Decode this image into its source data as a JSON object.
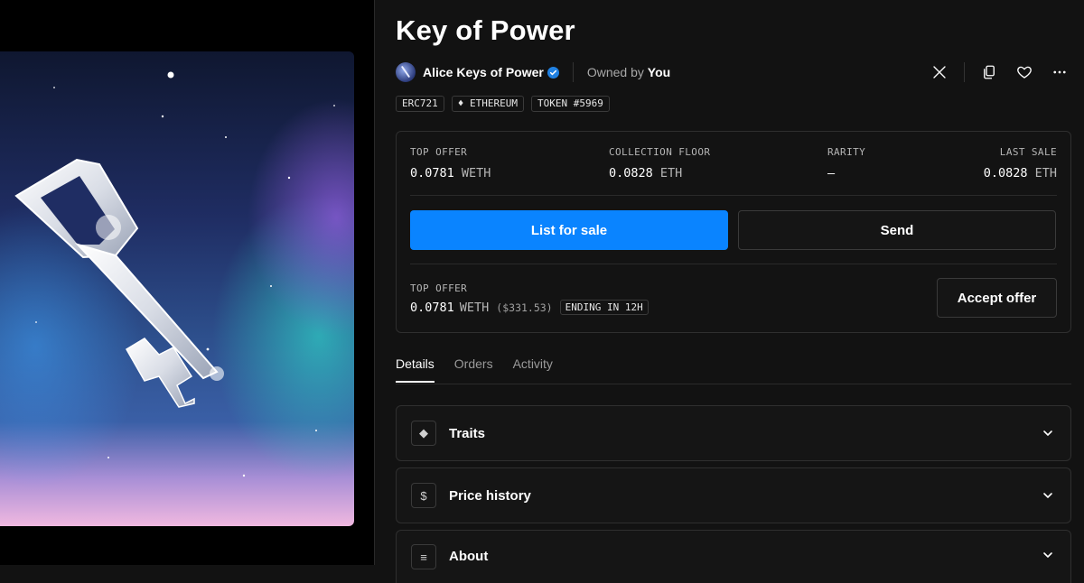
{
  "nft": {
    "title": "Key of Power",
    "collection_name": "Alice Keys of Power",
    "owned_by_label": "Owned by",
    "owner": "You"
  },
  "tags": [
    "ERC721",
    "ETHEREUM",
    "TOKEN #5969"
  ],
  "stats": {
    "top_offer": {
      "label": "TOP OFFER",
      "value": "0.0781",
      "unit": "WETH"
    },
    "floor": {
      "label": "COLLECTION FLOOR",
      "value": "0.0828",
      "unit": "ETH"
    },
    "rarity": {
      "label": "RARITY",
      "value": "–"
    },
    "last_sale": {
      "label": "LAST SALE",
      "value": "0.0828",
      "unit": "ETH"
    }
  },
  "actions": {
    "list": "List for sale",
    "send": "Send",
    "accept": "Accept offer"
  },
  "offer": {
    "label": "TOP OFFER",
    "value": "0.0781",
    "unit": "WETH",
    "usd": "($331.53)",
    "ending": "ENDING IN 12H"
  },
  "tabs": [
    "Details",
    "Orders",
    "Activity"
  ],
  "sections": [
    "Traits",
    "Price history",
    "About"
  ],
  "icons": [
    "x-icon",
    "copy-icon",
    "heart-icon",
    "more-icon",
    "verified-icon",
    "chevron-down-icon"
  ],
  "colors": {
    "accent": "#0a84ff",
    "background": "#121212"
  }
}
